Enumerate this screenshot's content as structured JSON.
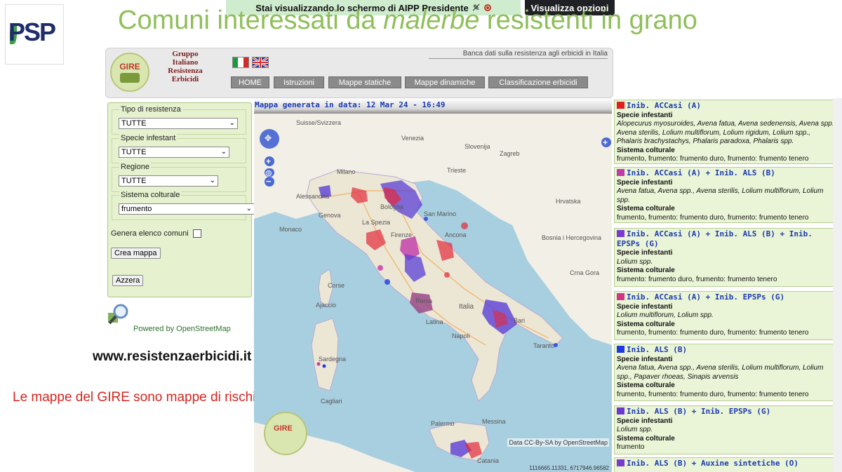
{
  "share_banner": {
    "text": "Stai visualizzando lo schermo di  AIPP Presidente",
    "view_options": "Visualizza opzioni"
  },
  "logo": {
    "text": "PSP"
  },
  "slide": {
    "title_part1": "Comuni interessati da ",
    "title_italic": "malerbe",
    "title_part2": " resistenti in grano",
    "website": "www.resistenzaerbicidi.it",
    "risk_note": "Le mappe del GIRE sono mappe di rischio",
    "powered_by": "Powered by OpenStreetMap"
  },
  "header": {
    "badge": "GIRE",
    "org_name": [
      "Gruppo",
      "Italiano",
      "Resistenza",
      "Erbicidi"
    ],
    "db_title": "Banca dati sulla resistenza agli erbicidi in Italia",
    "nav": [
      "HOME",
      "Istruzioni",
      "Mappe statiche",
      "Mappe dinamiche",
      "Classificazione erbicidi"
    ]
  },
  "filters": {
    "tipo_label": "Tipo di resistenza",
    "tipo_value": "TUTTE",
    "specie_label": "Specie infestant",
    "specie_value": "TUTTE",
    "regione_label": "Regione",
    "regione_value": "TUTTE",
    "sistema_label": "Sistema colturale",
    "sistema_value": "frumento",
    "genera_label": "Genera elenco comuni",
    "crea_button": "Crea mappa",
    "azzera_button": "Azzera"
  },
  "map": {
    "generated": "Mappa generata in data: 12 Mar 24 - 16:49",
    "attribution": "Data CC-By-SA by OpenStreetMap",
    "coords": "1116665.11331, 6717946.96582",
    "labels": [
      "Suisse/Svizzera",
      "Venezia",
      "Slovenija",
      "Zagreb",
      "Trieste",
      "Milano",
      "Alessandria",
      "Genova",
      "Bologna",
      "Firenze",
      "Ancona",
      "Monaco",
      "Corse",
      "Ajaccio",
      "Roma",
      "Italia",
      "Napoli",
      "Latina",
      "Bari",
      "Taranto",
      "Sardegna",
      "Cagliari",
      "Palermo",
      "Messina",
      "Catania",
      "Bosnia i Hercegovina",
      "Crna Gora",
      "Hrvatska",
      "San Marino",
      "La Spezia"
    ]
  },
  "legend": [
    {
      "color": "#e02020",
      "title": "Inib. ACCasi (A)",
      "species": "Alopecurus myosuroides, Avena fatua, Avena sedenensis, Avena spp., Avena sterilis, Lolium multiflorum, Lolium rigidum, Lolium spp., Phalaris brachystachys, Phalaris paradoxa, Phalaris spp.",
      "system": "frumento, frumento: frumento duro, frumento: frumento tenero"
    },
    {
      "color": "#c03aa8",
      "title": "Inib. ACCasi (A) + Inib. ALS (B)",
      "species": "Avena fatua, Avena spp., Avena sterilis, Lolium multiflorum, Lolium spp.",
      "system": "frumento, frumento: frumento duro, frumento: frumento tenero"
    },
    {
      "color": "#7a3ad0",
      "title": "Inib. ACCasi (A) + Inib. ALS (B) + Inib. EPSPs (G)",
      "species": "Lolium spp.",
      "system": "frumento: frumento duro, frumento: frumento tenero"
    },
    {
      "color": "#d0358a",
      "title": "Inib. ACCasi (A) + Inib. EPSPs (G)",
      "species": "Lolium multiflorum, Lolium spp.",
      "system": "frumento, frumento: frumento duro, frumento: frumento tenero"
    },
    {
      "color": "#1f3ae0",
      "title": "Inib. ALS (B)",
      "species": "Avena fatua, Avena spp., Avena sterilis, Lolium multiflorum, Lolium spp., Papaver rhoeas, Sinapis arvensis",
      "system": "frumento, frumento: frumento duro, frumento: frumento tenero"
    },
    {
      "color": "#6a3ad0",
      "title": "Inib. ALS (B) + Inib. EPSPs (G)",
      "species": "Lolium spp.",
      "system": "frumento"
    },
    {
      "color": "#7a3ad0",
      "title": "Inib. ALS (B) + Auxine sintetiche (O)",
      "species": "",
      "system": ""
    }
  ],
  "legend_headers": {
    "species": "Specie infestanti",
    "system": "Sistema colturale"
  }
}
